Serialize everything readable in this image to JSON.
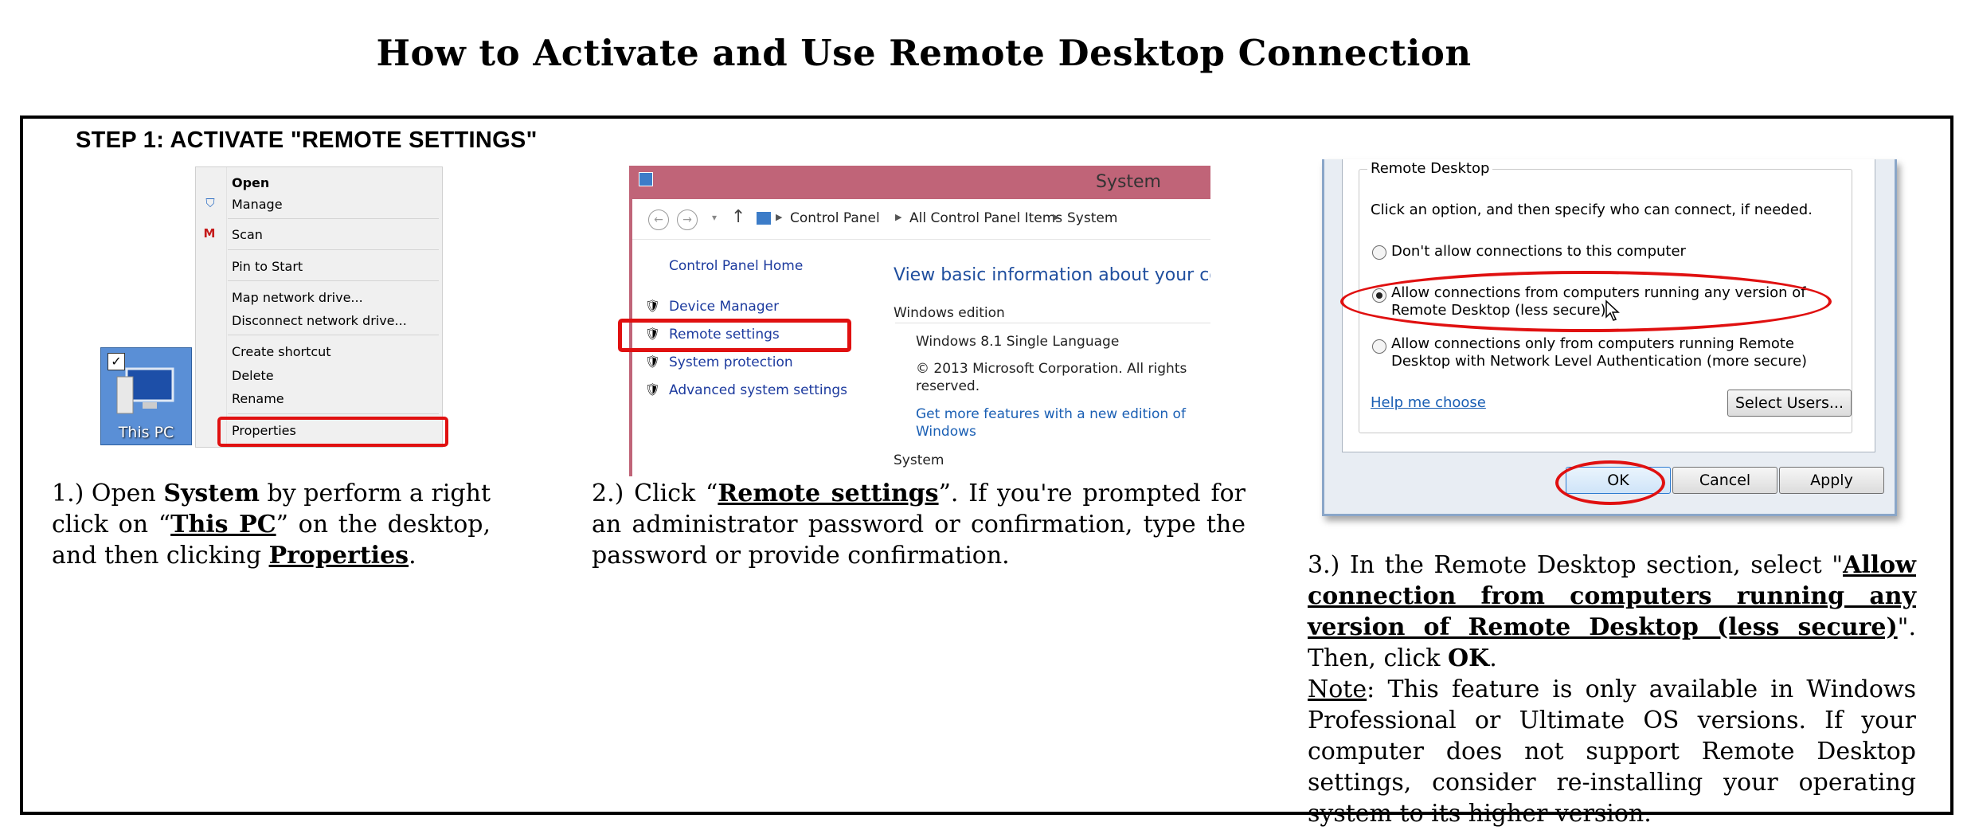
{
  "document": {
    "title": "How to Activate and Use Remote Desktop Connection",
    "step_heading": "STEP 1: ACTIVATE \"REMOTE SETTINGS\""
  },
  "panel1": {
    "menu_items": [
      "Open",
      "Manage",
      "Scan",
      "Pin to Start",
      "Map network drive...",
      "Disconnect network drive...",
      "Create shortcut",
      "Delete",
      "Rename",
      "Properties"
    ],
    "desktop_icon_label": "This PC",
    "caption": {
      "prefix": "1.) Open ",
      "system": "System",
      "mid1": " by perform a right click on “",
      "this_pc": "This PC",
      "mid2": "” on the desktop, and then clicking ",
      "properties": "Properties",
      "end": "."
    }
  },
  "panel2": {
    "window_title": "System",
    "breadcrumb": [
      "Control Panel",
      "Control Panel Items",
      "System"
    ],
    "sidebar": {
      "home": "Control Panel Home",
      "links": [
        "Device Manager",
        "Remote settings",
        "System protection",
        "Advanced system settings"
      ]
    },
    "main": {
      "heading": "View basic information about your com",
      "edition_label": "Windows edition",
      "edition_value": "Windows 8.1 Single Language",
      "copyright": "© 2013 Microsoft Corporation. All rights reserved.",
      "more_features": "Get more features with a new edition of Windows",
      "system_label": "System"
    },
    "caption": {
      "prefix": "2.) Click “",
      "remote_settings": "Remote settings",
      "rest": "”. If you're prompted for an administrator password or confirmation, type the password or provide confirmation."
    }
  },
  "panel3": {
    "group_label": "Remote Desktop",
    "instruction": "Click an option, and then specify who can connect, if needed.",
    "options": [
      {
        "label": "Don't allow connections to this computer",
        "selected": false
      },
      {
        "label": "Allow connections from computers running any version of Remote Desktop (less secure)",
        "selected": true
      },
      {
        "label": "Allow connections only from computers running Remote Desktop with Network Level Authentication (more secure)",
        "selected": false
      }
    ],
    "option_lines": [
      [
        "Don't allow connections to this computer"
      ],
      [
        "Allow connections from computers running any version of",
        "Remote Desktop (less secure)"
      ],
      [
        "Allow connections only from computers running Remote",
        "Desktop with Network Level Authentication (more secure)"
      ]
    ],
    "help_link": "Help me choose",
    "select_users": "Select Users...",
    "buttons": {
      "ok": "OK",
      "cancel": "Cancel",
      "apply": "Apply"
    },
    "caption": {
      "prefix": "3.) In the Remote Desktop section, select \"",
      "allow": "Allow connection from computers running any version of Remote Desktop (less secure)",
      "mid": "\". Then, click ",
      "ok": "OK",
      "end": ".",
      "note_label": "Note",
      "note_text": ": This feature is only available in Windows Professional or Ultimate OS versions. If your computer does not support Remote Desktop settings, consider re-installing your operating system to its higher version."
    }
  },
  "colors": {
    "highlight_red": "#e01010",
    "titlebar_pink": "#c06478",
    "link_blue": "#1c3a9e"
  }
}
